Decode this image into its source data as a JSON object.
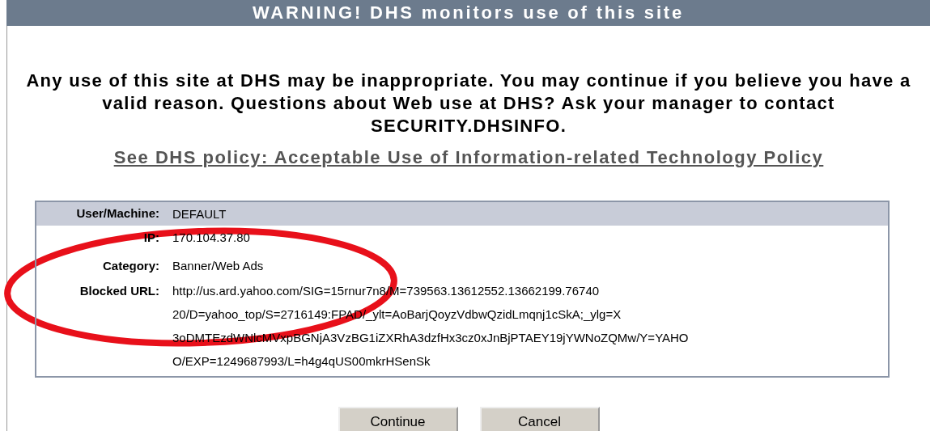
{
  "header": {
    "title": "WARNING! DHS monitors use of this site"
  },
  "message": "Any use of this site at DHS may be inappropriate. You may continue if you believe you have a valid reason. Questions about Web use at DHS? Ask your manager to contact SECURITY.DHSINFO.",
  "policy_link": "See DHS policy: Acceptable Use of Information-related Technology Policy",
  "details": [
    {
      "label": "User/Machine:",
      "value_lines": [
        "DEFAULT"
      ],
      "highlighted": true
    },
    {
      "label": "IP:",
      "value_lines": [
        "170.104.37.80"
      ],
      "highlighted": false
    },
    {
      "label": "Category:",
      "value_lines": [
        "Banner/Web Ads"
      ],
      "highlighted": false
    },
    {
      "label": "Blocked URL:",
      "value_lines": [
        "http://us.ard.yahoo.com/SIG=15rnur7n8/M=739563.13612552.13662199.76740",
        "20/D=yahoo_top/S=2716149:FPAD/_ylt=AoBarjQoyzVdbwQzidLmqnj1cSkA;_ylg=X",
        "3oDMTEzdWNlcMVxpBGNjA3VzBG1iZXRhA3dzfHx3cz0xJnBjPTAEY19jYWNoZQMw/Y=YAHO",
        "O/EXP=1249687993/L=h4g4qUS00mkrHSenSk"
      ],
      "highlighted": false
    }
  ],
  "buttons": [
    "Continue",
    "Cancel"
  ]
}
